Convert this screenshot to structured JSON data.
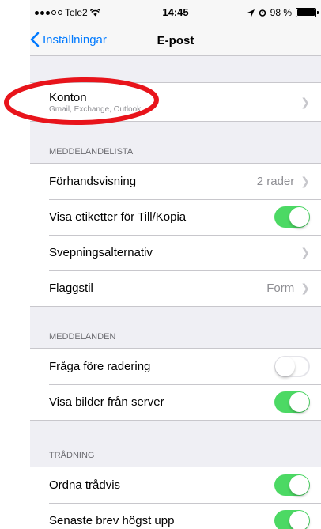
{
  "status_bar": {
    "carrier": "Tele2",
    "time": "14:45",
    "battery": "98 %",
    "battery_level": 0.98
  },
  "nav": {
    "back_label": "Inställningar",
    "title": "E-post"
  },
  "accounts": {
    "label": "Konton",
    "subtitle": "Gmail, Exchange, Outlook"
  },
  "sections": [
    {
      "header": "MEDDELANDELISTA",
      "rows": [
        {
          "label": "Förhandsvisning",
          "detail": "2 rader",
          "accessory": "chevron"
        },
        {
          "label": "Visa etiketter för Till/Kopia",
          "accessory": "toggle",
          "on": true
        },
        {
          "label": "Svepningsalternativ",
          "accessory": "chevron"
        },
        {
          "label": "Flaggstil",
          "detail": "Form",
          "accessory": "chevron"
        }
      ]
    },
    {
      "header": "MEDDELANDEN",
      "rows": [
        {
          "label": "Fråga före radering",
          "accessory": "toggle",
          "on": false
        },
        {
          "label": "Visa bilder från server",
          "accessory": "toggle",
          "on": true
        }
      ]
    },
    {
      "header": "TRÅDNING",
      "rows": [
        {
          "label": "Ordna trådvis",
          "accessory": "toggle",
          "on": true
        },
        {
          "label": "Senaste brev högst upp",
          "accessory": "toggle",
          "on": true
        }
      ]
    }
  ],
  "colors": {
    "accent": "#007aff",
    "toggle_on": "#4cd964",
    "annotation": "#e8141b"
  },
  "icons": {
    "back": "chevron-left-icon",
    "row_chevron": "chevron-right-icon",
    "wifi": "wifi-icon",
    "location": "location-arrow-icon",
    "alarm": "alarm-icon"
  }
}
